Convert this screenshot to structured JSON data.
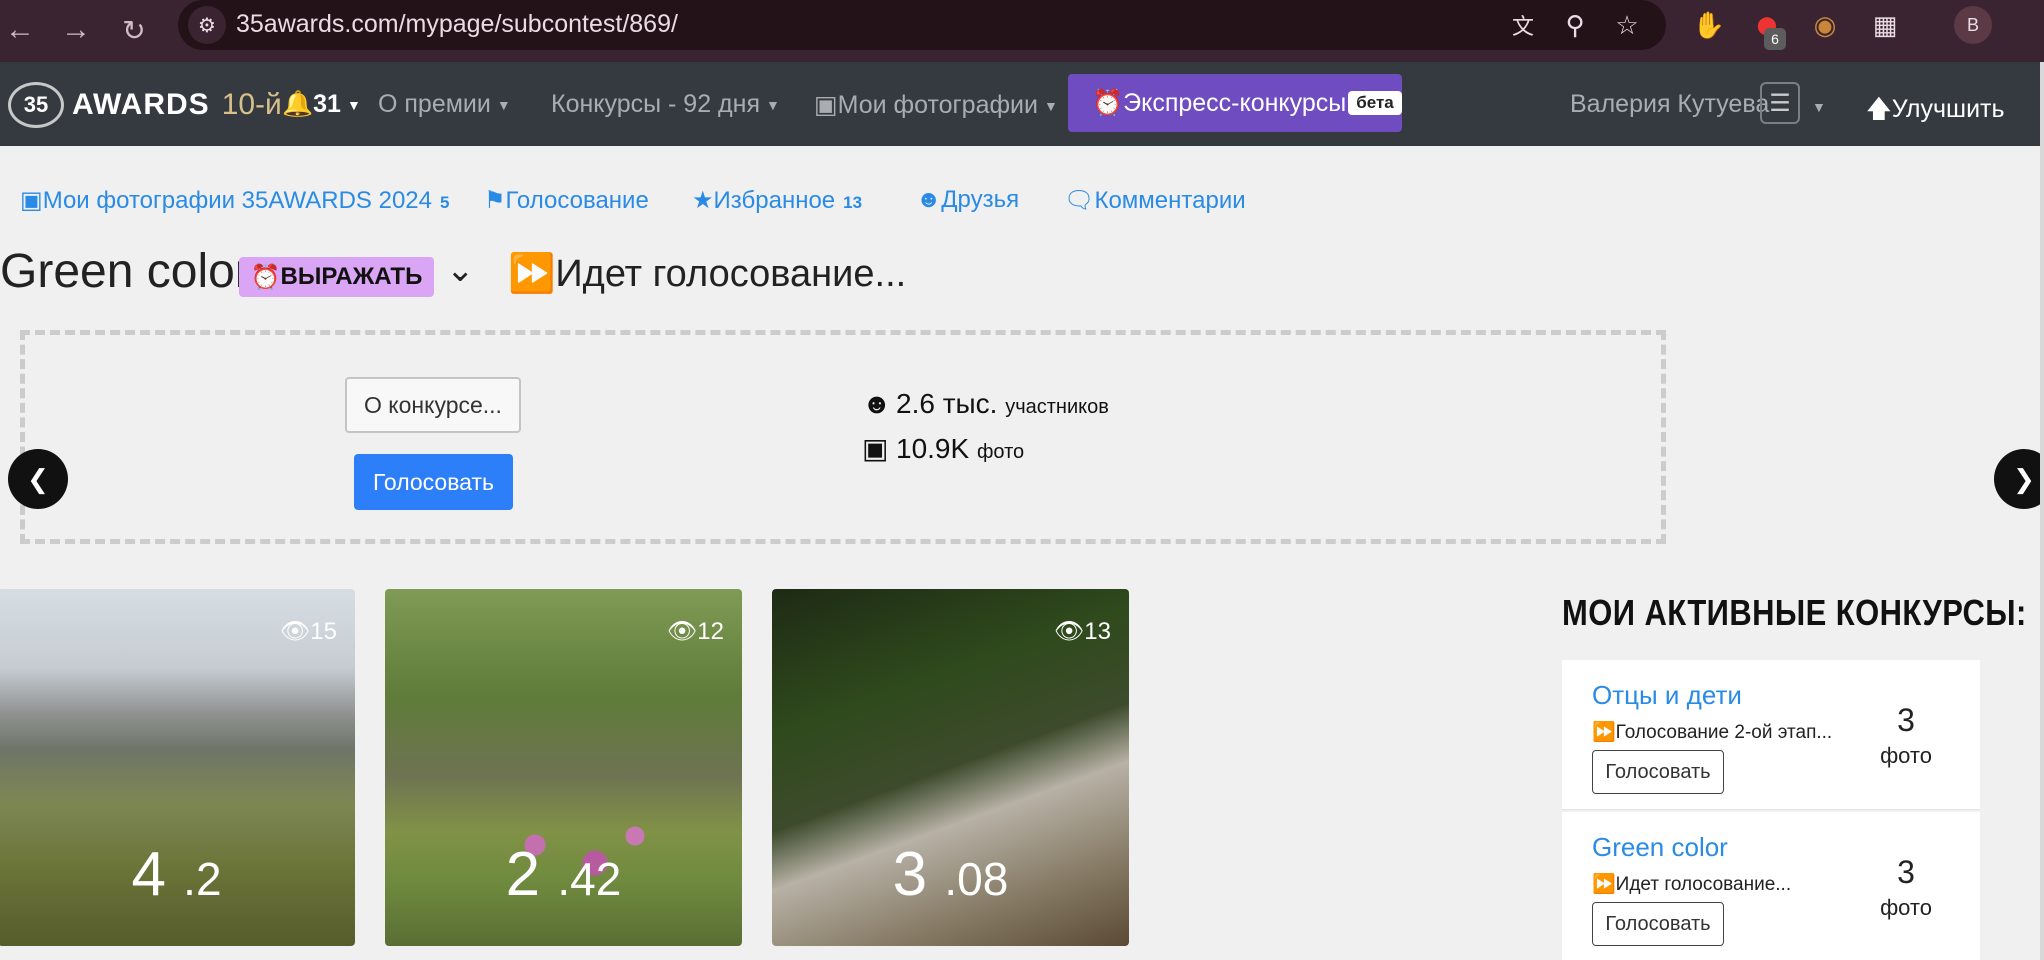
{
  "browser": {
    "url": "35awards.com/mypage/subcontest/869/",
    "extension_badge": "6",
    "profile_initial": "В"
  },
  "site_nav": {
    "logo_text": "AWARDS",
    "logo_year": "10-й",
    "notifications": "31",
    "about": "О премии",
    "contests": "Конкурсы - 92 дня",
    "my_photos": "Мои фотографии",
    "express": "Экспресс-конкурсы",
    "express_beta": "бета",
    "user_name": "Валерия Кутуева",
    "upgrade": "Улучшить"
  },
  "sub_nav": {
    "my_photos": "Мои фотографии 35AWARDS 2024",
    "my_photos_count": "5",
    "voting": "Голосование",
    "favorites": "Избранное",
    "favorites_count": "13",
    "friends": "Друзья",
    "comments": "Комментарии"
  },
  "contest": {
    "title": "Green color",
    "express_badge": "ВЫРАЖАТЬ",
    "status": "Идет голосование...",
    "about_button": "О конкурсе...",
    "vote_button": "Голосовать",
    "participants_value": "2.6 тыс.",
    "participants_label": "участников",
    "photos_value": "10.9K",
    "photos_label": "фото"
  },
  "photos": [
    {
      "views": "15",
      "score_int": "4",
      "score_dec": ".2"
    },
    {
      "views": "12",
      "score_int": "2",
      "score_dec": ".42"
    },
    {
      "views": "13",
      "score_int": "3",
      "score_dec": ".08"
    }
  ],
  "sidebar": {
    "title": "Мои активные конкурсы:",
    "cards": [
      {
        "title": "Отцы и дети",
        "status": "Голосование 2-ой этап...",
        "button": "Голосовать",
        "count": "3",
        "count_label": "фото"
      },
      {
        "title": "Green color",
        "status": "Идет голосование...",
        "button": "Голосовать",
        "count": "3",
        "count_label": "фото"
      }
    ]
  }
}
